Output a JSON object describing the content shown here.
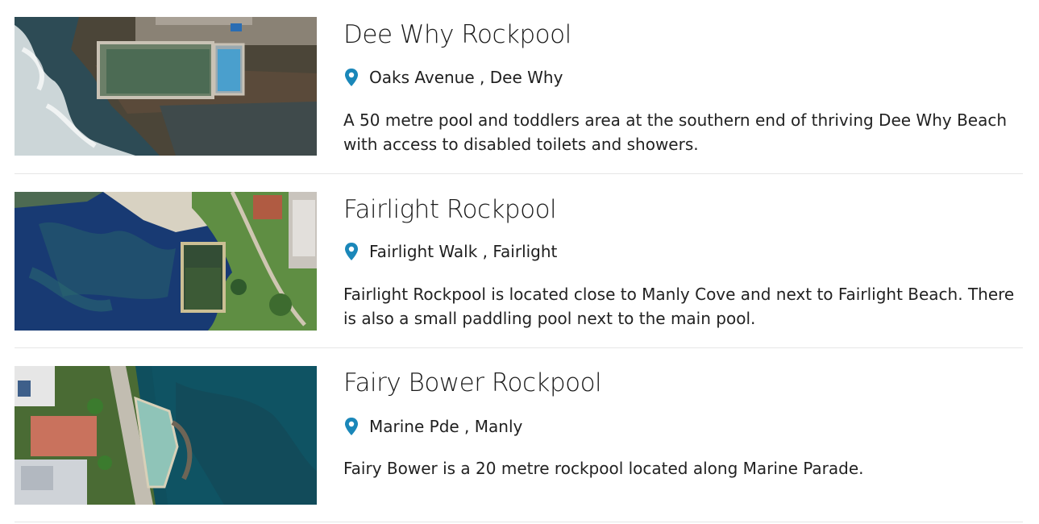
{
  "listings": [
    {
      "title": "Dee Why Rockpool",
      "street": "Oaks Avenue",
      "suburb": "Dee Why",
      "description": "A 50 metre pool and toddlers area at the southern end of thriving Dee Why Beach with access to disabled toilets and showers."
    },
    {
      "title": "Fairlight Rockpool",
      "street": "Fairlight Walk",
      "suburb": "Fairlight",
      "description": "Fairlight Rockpool is located close to Manly Cove and next to Fairlight Beach. There is also a small paddling pool next to the main pool."
    },
    {
      "title": "Fairy Bower Rockpool",
      "street": "Marine Pde",
      "suburb": "Manly",
      "description": "Fairy Bower is a 20 metre rockpool located along Marine Parade."
    }
  ],
  "icons": {
    "location": "map-pin-icon"
  },
  "colors": {
    "pin": "#1a87b9",
    "divider": "#e6e6e6"
  }
}
